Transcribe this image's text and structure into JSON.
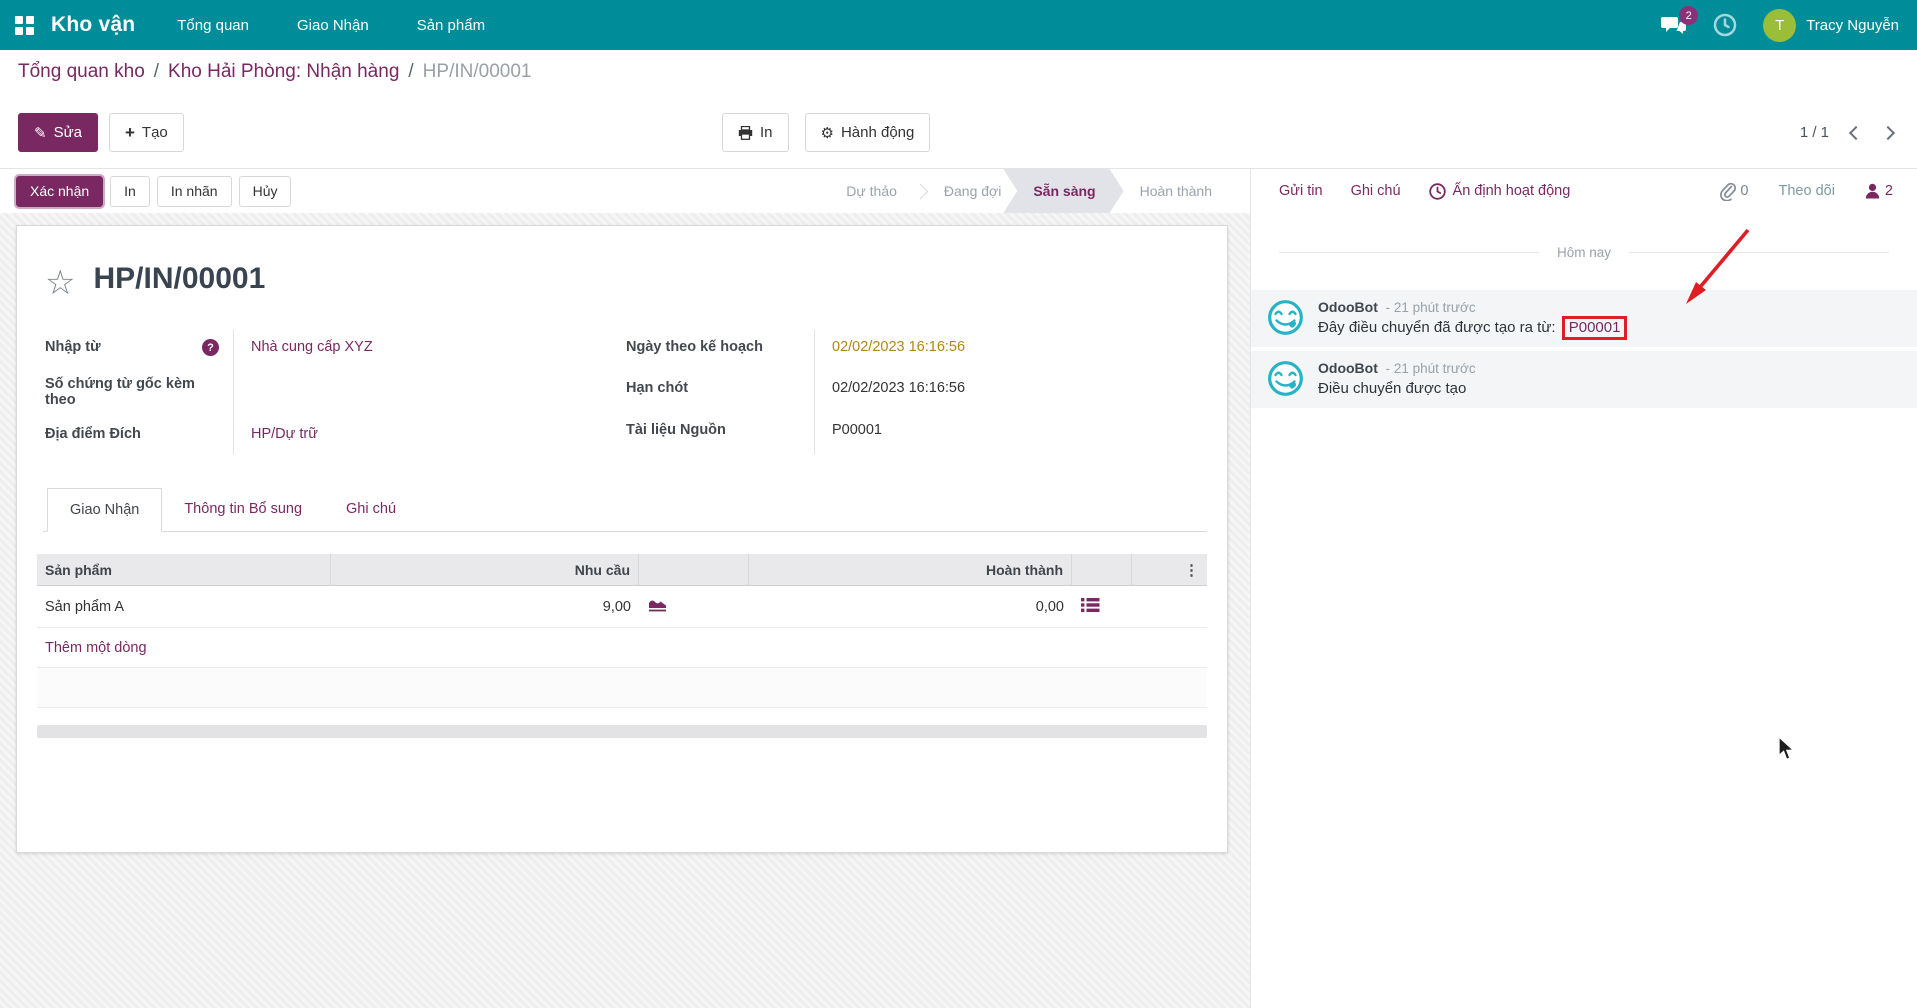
{
  "colors": {
    "navbar_teal": "#008d9a",
    "primary_purple": "#7a2862",
    "amber_date": "#b3860e",
    "avatar_green": "#9abd3a",
    "odoobot_teal": "#27b3c6",
    "annotation_red": "#df1d24"
  },
  "icons": {
    "pencil": "✎",
    "plus": "+",
    "gear": "⚙",
    "star": "☆",
    "question": "?",
    "dots_vertical": "⋮",
    "slash": "/"
  },
  "navbar": {
    "brand": "Kho vận",
    "menus": [
      "Tổng quan",
      "Giao Nhận",
      "Sản phẩm"
    ],
    "messages_badge": "2",
    "user_initial": "T",
    "user_name": "Tracy Nguyễn"
  },
  "breadcrumb": {
    "items": [
      "Tổng quan kho",
      "Kho Hải Phòng: Nhận hàng"
    ],
    "current": "HP/IN/00001"
  },
  "actions": {
    "edit": "Sửa",
    "create": "Tạo",
    "print": "In",
    "action": "Hành động",
    "pager": "1 / 1"
  },
  "statusbar": {
    "buttons": [
      "Xác nhận",
      "In",
      "In nhãn",
      "Hủy"
    ],
    "stages": [
      "Dự thảo",
      "Đang đợi",
      "Sẵn sàng",
      "Hoàn thành"
    ],
    "active_stage": "Sẵn sàng"
  },
  "form": {
    "title": "HP/IN/00001",
    "fields": {
      "partner_label": "Nhập từ",
      "partner_value": "Nhà cung cấp XYZ",
      "origin_label": "Số chứng từ gốc kèm theo",
      "origin_value": "",
      "dest_label": "Địa điểm Đích",
      "dest_value": "HP/Dự trữ",
      "scheduled_label": "Ngày theo kế hoạch",
      "scheduled_value": "02/02/2023 16:16:56",
      "deadline_label": "Hạn chót",
      "deadline_value": "02/02/2023 16:16:56",
      "source_label": "Tài liệu Nguồn",
      "source_value": "P00001"
    },
    "tabs": [
      "Giao Nhận",
      "Thông tin Bổ sung",
      "Ghi chú"
    ],
    "active_tab": "Giao Nhận",
    "table": {
      "headers": {
        "product": "Sản phẩm",
        "demand": "Nhu cầu",
        "done": "Hoàn thành"
      },
      "rows": [
        {
          "product": "Sản phẩm A",
          "demand": "9,00",
          "done": "0,00"
        }
      ],
      "add_line": "Thêm một dòng"
    }
  },
  "chatter": {
    "send": "Gửi tin",
    "note": "Ghi chú",
    "activity": "Ấn định hoạt động",
    "attach_count": "0",
    "follow": "Theo dõi",
    "followers_count": "2",
    "date_divider": "Hôm nay",
    "messages": [
      {
        "author": "OdooBot",
        "time": "- 21 phút trước",
        "body_prefix": "Đây điều chuyển đã được tạo ra từ:",
        "link": "P00001"
      },
      {
        "author": "OdooBot",
        "time": "- 21 phút trước",
        "body": "Điều chuyển được tạo"
      }
    ]
  }
}
